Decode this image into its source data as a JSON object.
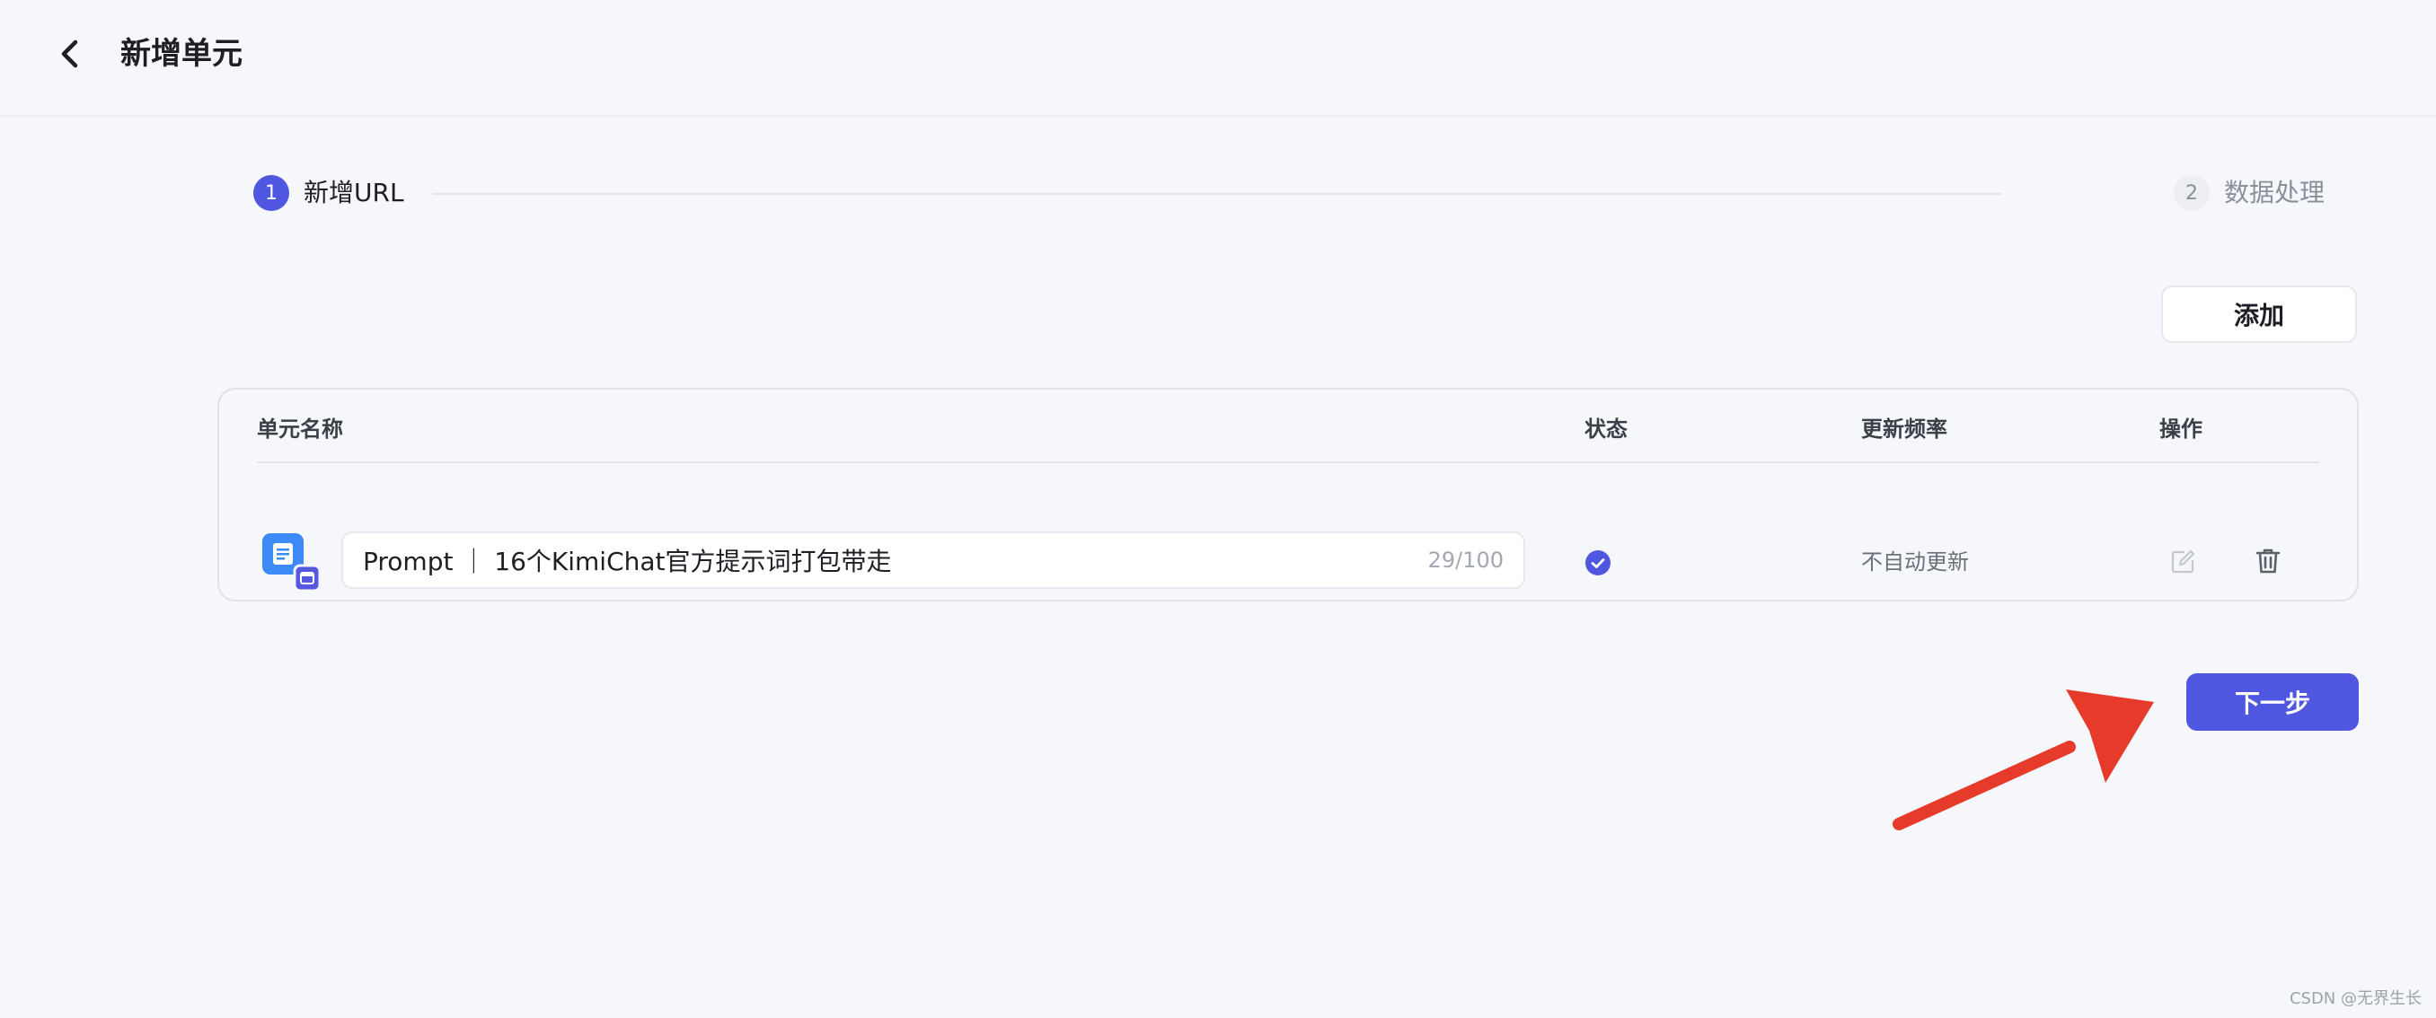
{
  "header": {
    "back_icon": "chevron-left-icon",
    "title": "新增单元"
  },
  "steps": [
    {
      "number": "1",
      "label": "新增URL",
      "state": "active"
    },
    {
      "number": "2",
      "label": "数据处理",
      "state": "inactive"
    }
  ],
  "toolbar": {
    "add_label": "添加"
  },
  "table": {
    "columns": [
      "单元名称",
      "状态",
      "更新频率",
      "操作"
    ],
    "rows": [
      {
        "icon": "document-link-icon",
        "name": "Prompt ｜ 16个KimiChat官方提示词打包带走",
        "char_count": "29/100",
        "status_icon": "check-circle-icon",
        "update_frequency": "不自动更新",
        "actions": [
          "edit-icon",
          "delete-icon"
        ]
      }
    ]
  },
  "footer": {
    "next_label": "下一步"
  },
  "watermark": "CSDN @无界生长",
  "colors": {
    "primary": "#4f56e0",
    "background": "#f6f7fb",
    "annotation_arrow": "#e63a2a"
  }
}
